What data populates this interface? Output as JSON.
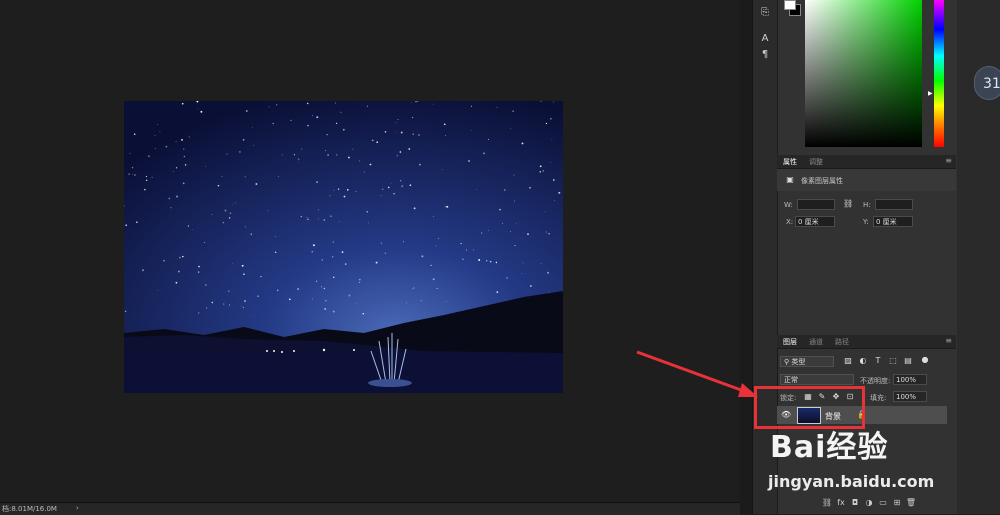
{
  "status": {
    "doc_size": "档:8.01M/16.0M",
    "arrow": "›"
  },
  "badge": {
    "text": "31"
  },
  "colors": {
    "accent": "#e8323a",
    "foreground": "#ffffff",
    "background": "#000000"
  },
  "properties": {
    "tabs": [
      "属性",
      "调整"
    ],
    "title": "像素图层属性",
    "w_label": "W:",
    "h_label": "H:",
    "x_label": "X:",
    "x_value": "0 厘米",
    "y_label": "Y:",
    "y_value": "0 厘米"
  },
  "layers": {
    "tabs": [
      "图层",
      "通道",
      "路径"
    ],
    "filter_kind": "类型",
    "blend_mode": "正常",
    "opacity_label": "不透明度:",
    "opacity_value": "100%",
    "lock_label": "锁定:",
    "fill_label": "填充:",
    "fill_value": "100%",
    "layer_name": "背景"
  },
  "watermark": {
    "brand": "Bai经验",
    "url": "jingyan.baidu.com"
  },
  "icons": [
    "text-tool-icon",
    "paragraph-icon",
    "layer-style-icon",
    "mask-icon",
    "adjustment-icon",
    "folder-icon",
    "new-layer-icon",
    "trash-icon"
  ]
}
